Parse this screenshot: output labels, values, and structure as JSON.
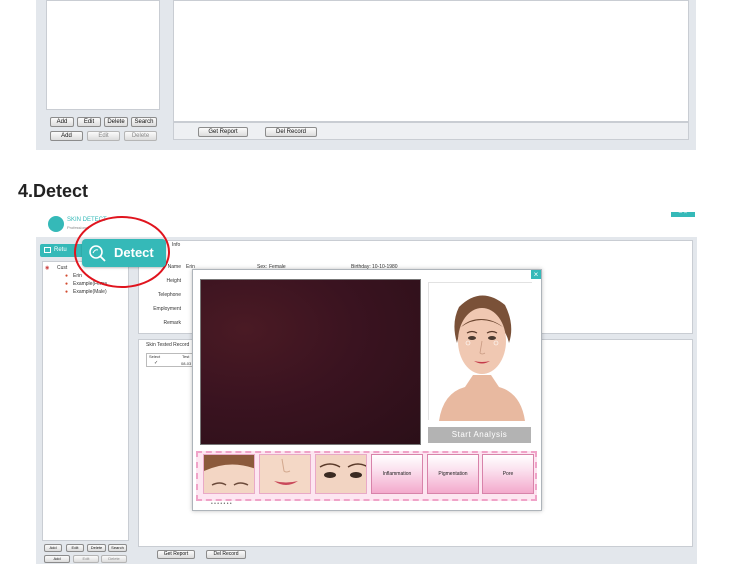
{
  "top_screenshot": {
    "left_buttons_row1": [
      "Add",
      "Edit",
      "Delete",
      "Search"
    ],
    "left_buttons_row2": [
      "Add",
      "Edit",
      "Delete"
    ],
    "get_report": "Get Report",
    "del_record": "Del Record"
  },
  "section_heading": "4.Detect",
  "app": {
    "logo_text": "SKIN DETECT",
    "logo_sub": "Professional",
    "window_controls": "– ×",
    "nav_back": "Retu",
    "detect_label": "Detect",
    "info_tab": "Info",
    "tree": {
      "root": "Cust",
      "items": [
        "Erin",
        "Example(Fema",
        "Example(Male)"
      ]
    },
    "customer": {
      "name_label": "Name",
      "name_value": "Erin",
      "sex_label": "Sex:",
      "sex_value": "Female",
      "birthday_label": "Birthday:",
      "birthday_value": "10-10-1980",
      "height_label": "Height",
      "telephone_label": "Telephone",
      "employment_label": "Employment",
      "remark_label": "Remark"
    },
    "tested_record": {
      "title": "Skin Tested Record",
      "col_select": "Select",
      "col_test": "Test",
      "row_check": "✓",
      "row_date": "08-03"
    },
    "left_buttons_row1": [
      "Add",
      "Edit",
      "Delete",
      "Search"
    ],
    "left_buttons_row2": [
      "Add",
      "Edit",
      "Delete"
    ],
    "get_report": "Get Report",
    "del_record": "Del Record"
  },
  "dialog": {
    "close": "×",
    "start_analysis": "Start Analysis",
    "categories": [
      "Inflammation",
      "Pigmentation",
      "Pore"
    ],
    "page_dots": "• • • • • • •"
  },
  "colors": {
    "accent_teal": "#35b9b8",
    "highlight_red": "#e0141e",
    "camera_dark": "#3a1320",
    "pink": "#f3a9cc"
  }
}
